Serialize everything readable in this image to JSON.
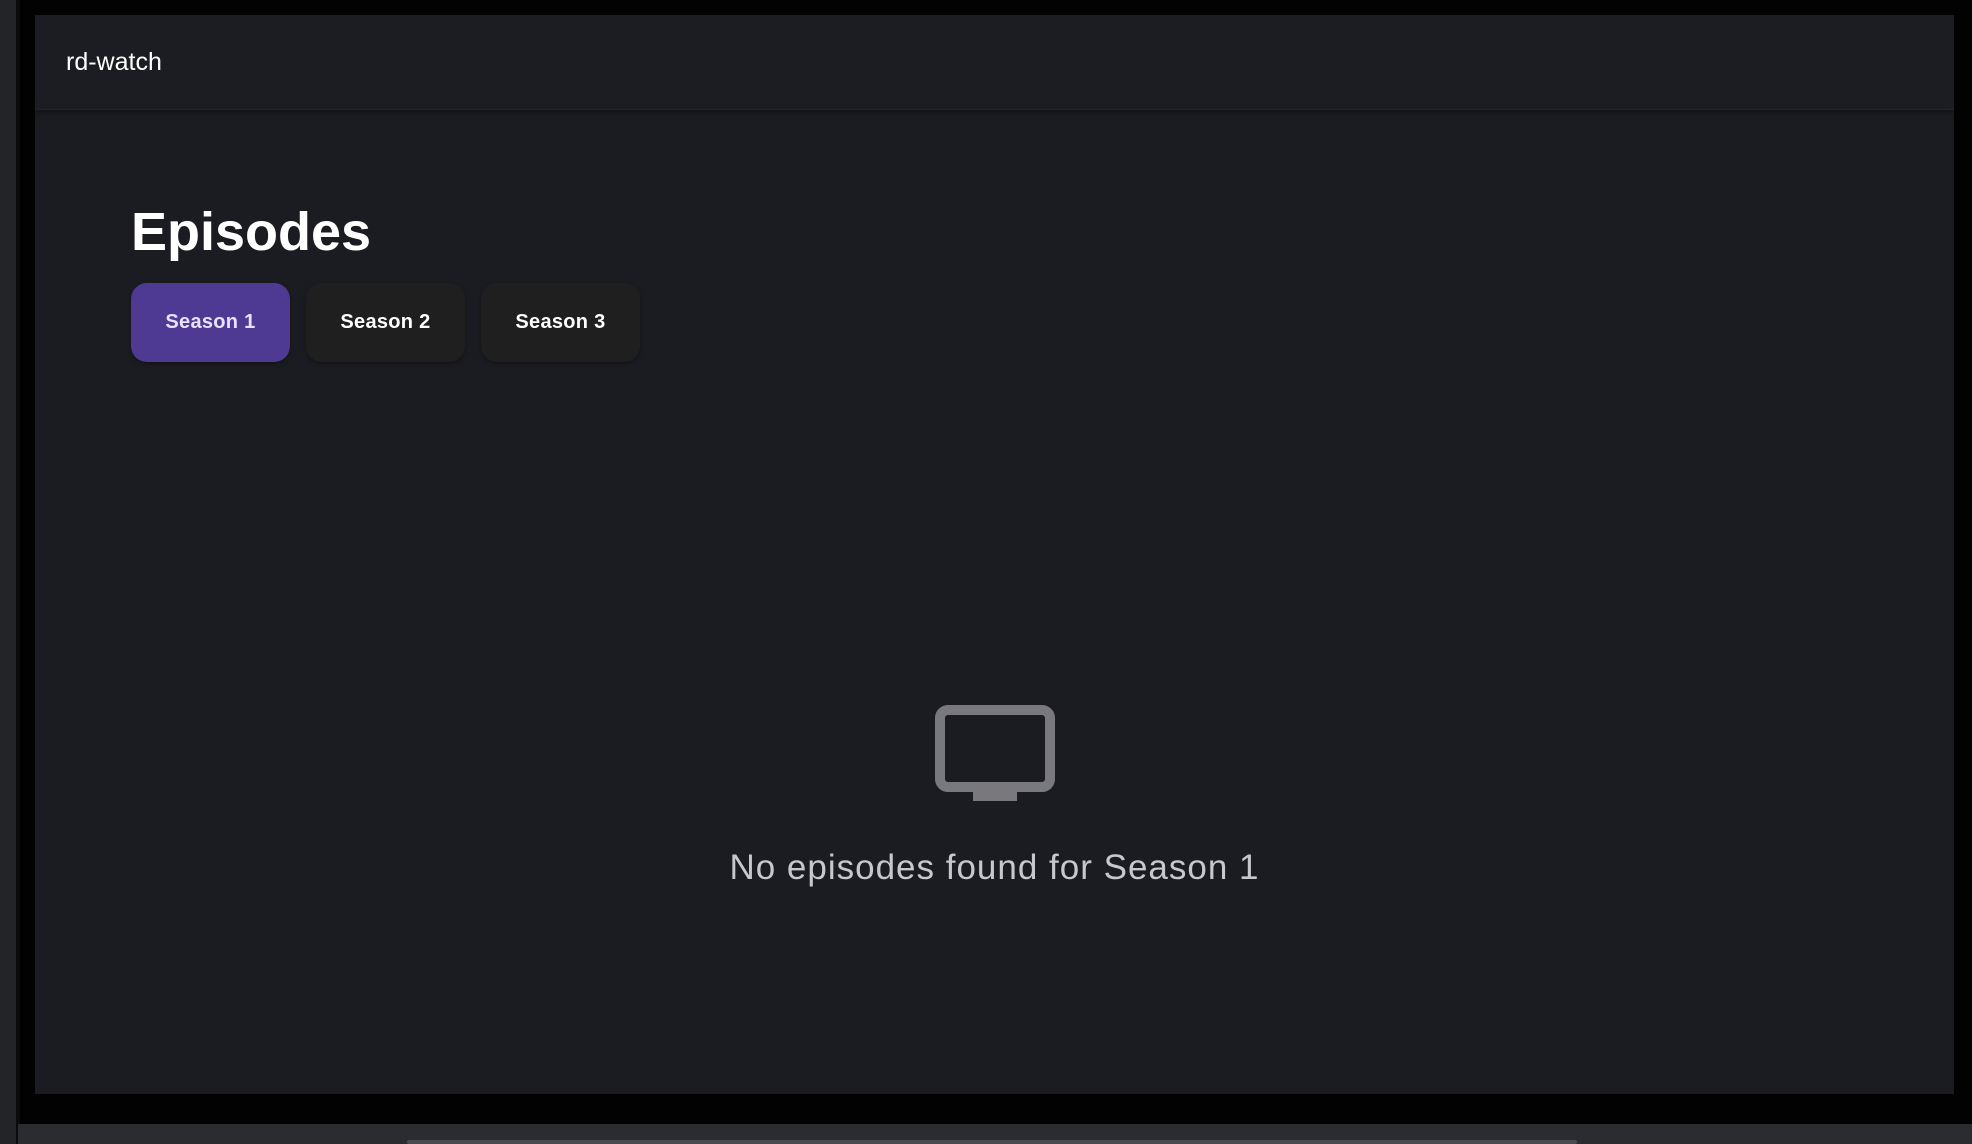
{
  "app": {
    "brand": "rd-watch"
  },
  "page": {
    "title": "Episodes"
  },
  "season_tabs": [
    {
      "label": "Season 1",
      "selected": true
    },
    {
      "label": "Season 2",
      "selected": false
    },
    {
      "label": "Season 3",
      "selected": false
    }
  ],
  "empty_state": {
    "icon": "tv-icon",
    "message": "No episodes found for Season 1"
  },
  "colors": {
    "background": "#1b1c21",
    "accent": "#4e3a93",
    "tab_background": "#1f1f20",
    "icon": "#78787d",
    "message_text": "#c7c8cc"
  }
}
